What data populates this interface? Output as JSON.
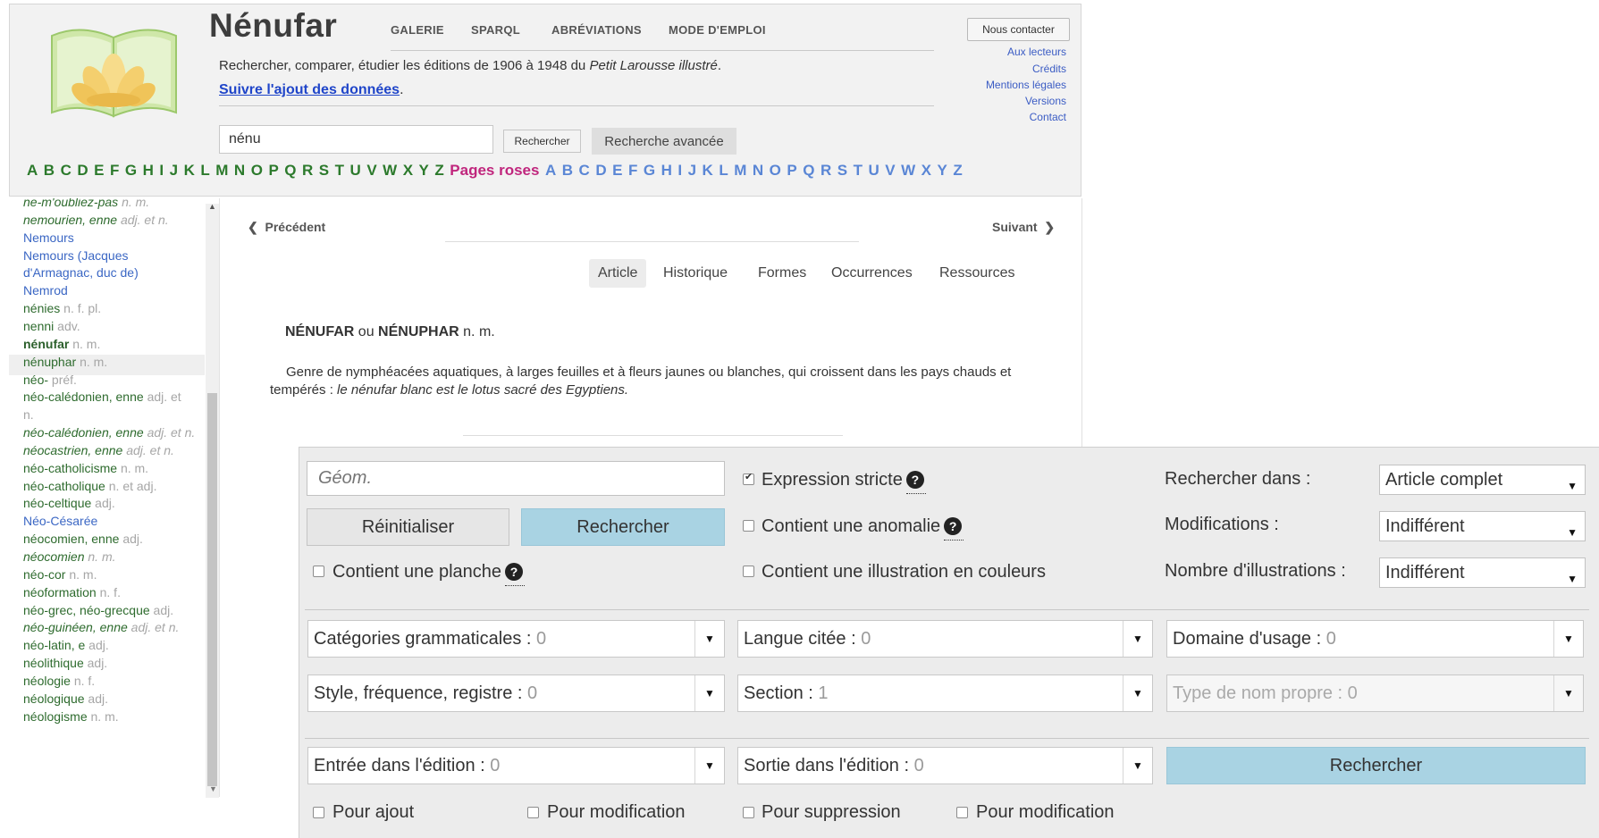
{
  "header": {
    "title": "Nénufar",
    "nav": [
      "GALERIE",
      "SPARQL",
      "ABRÉVIATIONS",
      "MODE D'EMPLOI"
    ],
    "tagline_prefix": "Rechercher, comparer, étudier les éditions de 1906 à 1948 du ",
    "tagline_italic": "Petit Larousse illustré",
    "tagline_suffix": ".",
    "follow_link": "Suivre l'ajout des données",
    "follow_suffix": ".",
    "search_value": "nénu",
    "search_button": "Rechercher",
    "advanced_button": "Recherche avancée",
    "contact_button": "Nous contacter",
    "right_links": [
      "Aux lecteurs",
      "Crédits",
      "Mentions légales",
      "Versions",
      "Contact"
    ],
    "alphabet": [
      "A",
      "B",
      "C",
      "D",
      "E",
      "F",
      "G",
      "H",
      "I",
      "J",
      "K",
      "L",
      "M",
      "N",
      "O",
      "P",
      "Q",
      "R",
      "S",
      "T",
      "U",
      "V",
      "W",
      "X",
      "Y",
      "Z"
    ],
    "pages_roses": "Pages roses"
  },
  "sidebar": {
    "items": [
      {
        "word": "ne-m'oubliez-pas",
        "pos": "n. m.",
        "italic": true
      },
      {
        "word": "nemourien, enne",
        "pos": "adj. et n.",
        "italic": true
      },
      {
        "word": "Nemours",
        "pos": "",
        "proper": true
      },
      {
        "word": "Nemours (Jacques",
        "pos": "",
        "proper": true
      },
      {
        "word": "d'Armagnac, duc de)",
        "pos": "",
        "proper": true
      },
      {
        "word": "Nemrod",
        "pos": "",
        "proper": true
      },
      {
        "word": "nénies",
        "pos": "n. f. pl."
      },
      {
        "word": "nenni",
        "pos": "adv."
      },
      {
        "word": "nénufar",
        "pos": "n. m.",
        "selected": true
      },
      {
        "word": "nénuphar",
        "pos": "n. m."
      },
      {
        "word": "néo-",
        "pos": "préf."
      },
      {
        "word": "néo-calédonien, enne",
        "pos": "adj. et"
      },
      {
        "word": "",
        "pos": "n."
      },
      {
        "word": "néo-calédonien, enne",
        "pos": "adj. et n.",
        "italic": true
      },
      {
        "word": "néocastrien, enne",
        "pos": "adj. et n.",
        "italic": true
      },
      {
        "word": "néo-catholicisme",
        "pos": "n. m."
      },
      {
        "word": "néo-catholique",
        "pos": "n. et adj."
      },
      {
        "word": "néo-celtique",
        "pos": "adj."
      },
      {
        "word": "Néo-Césarée",
        "pos": "",
        "proper": true
      },
      {
        "word": "néocomien, enne",
        "pos": "adj."
      },
      {
        "word": "néocomien",
        "pos": "n. m.",
        "italic": true
      },
      {
        "word": "néo-cor",
        "pos": "n. m."
      },
      {
        "word": "néoformation",
        "pos": "n. f."
      },
      {
        "word": "néo-grec, néo-grecque",
        "pos": "adj."
      },
      {
        "word": "néo-guinéen, enne",
        "pos": "adj. et n.",
        "italic": true
      },
      {
        "word": "néo-latin, e",
        "pos": "adj."
      },
      {
        "word": "néolithique",
        "pos": "adj."
      },
      {
        "word": "néologie",
        "pos": "n. f."
      },
      {
        "word": "néologique",
        "pos": "adj."
      },
      {
        "word": "néologisme",
        "pos": "n. m."
      }
    ]
  },
  "article": {
    "prev": "Précédent",
    "next": "Suivant",
    "tabs": [
      "Article",
      "Historique",
      "Formes",
      "Occurrences",
      "Ressources"
    ],
    "head_word1": "NÉNUFAR",
    "head_or": " ou ",
    "head_word2": "NÉNUPHAR",
    "head_pos": " n. m.",
    "definition": "Genre de nymphéacées aquatiques, à larges feuilles et à fleurs jaunes ou blanches, qui croissent dans les pays chauds et tempérés : ",
    "example": "le nénufar blanc est le lotus sacré des Egyptiens."
  },
  "panel": {
    "query_placeholder": "Géom.",
    "reset_button": "Réinitialiser",
    "search_button": "Rechercher",
    "expression_stricte": "Expression stricte",
    "contient_anomalie": "Contient une anomalie",
    "contient_planche": "Contient une planche",
    "contient_illustration": "Contient une illustration en couleurs",
    "rechercher_dans_label": "Rechercher dans :",
    "rechercher_dans_value": "Article complet",
    "modifications_label": "Modifications :",
    "modifications_value": "Indifférent",
    "nb_illustrations_label": "Nombre d'illustrations :",
    "nb_illustrations_value": "Indifférent",
    "filters": {
      "cat_gram": {
        "label": "Catégories grammaticales : ",
        "count": "0"
      },
      "langue": {
        "label": "Langue citée : ",
        "count": "0"
      },
      "domaine": {
        "label": "Domaine d'usage : ",
        "count": "0"
      },
      "style": {
        "label": "Style, fréquence, registre : ",
        "count": "0"
      },
      "section": {
        "label": "Section : ",
        "count": "1"
      },
      "type_nom": {
        "label": "Type de nom propre : ",
        "count": "0"
      },
      "entree": {
        "label": "Entrée dans l'édition : ",
        "count": "0"
      },
      "sortie": {
        "label": "Sortie dans l'édition : ",
        "count": "0"
      }
    },
    "bottom_search": "Rechercher",
    "pour_ajout": "Pour ajout",
    "pour_modification_1": "Pour modification",
    "pour_suppression": "Pour suppression",
    "pour_modification_2": "Pour modification"
  }
}
